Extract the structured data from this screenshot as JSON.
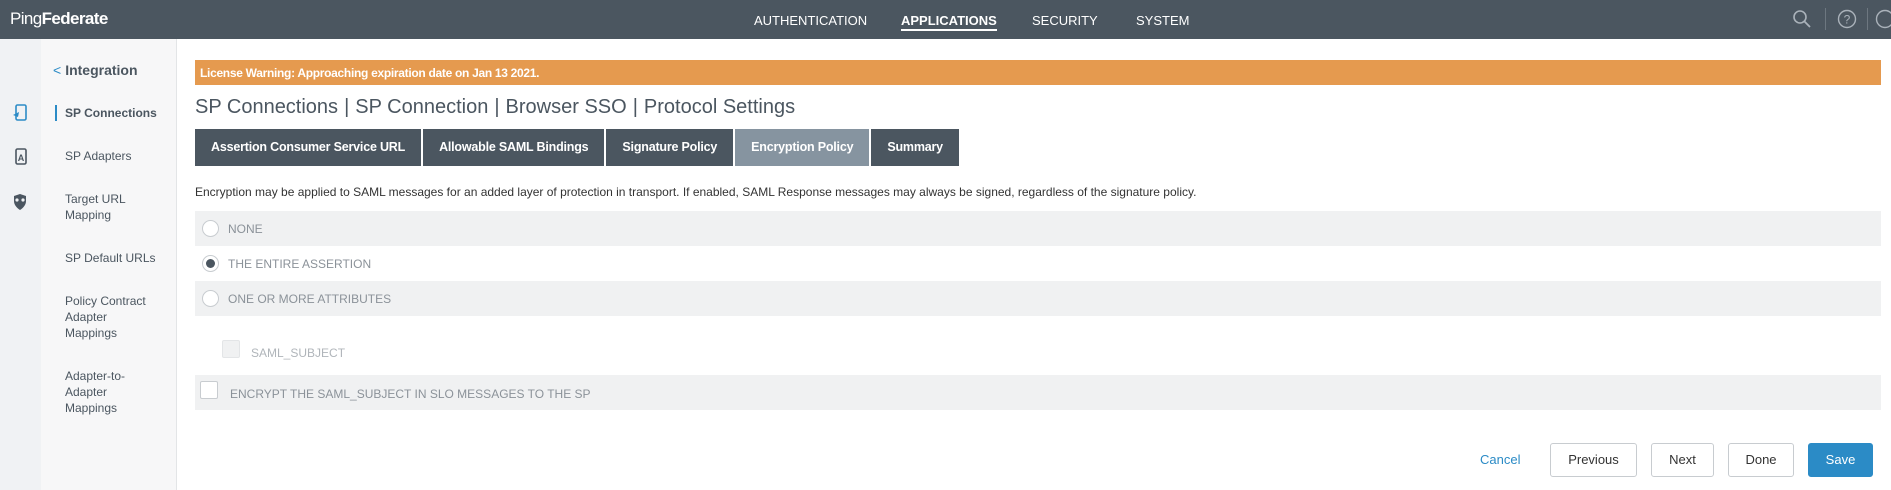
{
  "app": {
    "logo_regular": "Ping",
    "logo_bold": "Federate"
  },
  "nav": {
    "items": [
      "AUTHENTICATION",
      "APPLICATIONS",
      "SECURITY",
      "SYSTEM"
    ],
    "active": "APPLICATIONS"
  },
  "subnav": {
    "back_label": "Integration",
    "items": [
      {
        "label": "SP Connections",
        "active": true
      },
      {
        "label": "SP Adapters"
      },
      {
        "label": "Target URL Mapping"
      },
      {
        "label": "SP Default URLs"
      },
      {
        "label": "Policy Contract Adapter Mappings"
      },
      {
        "label": "Adapter-to-Adapter Mappings"
      }
    ]
  },
  "warning": "License Warning: Approaching expiration date on Jan 13 2021.",
  "breadcrumb": [
    "SP Connections",
    "SP Connection",
    "Browser SSO",
    "Protocol Settings"
  ],
  "tabs": [
    "Assertion Consumer Service URL",
    "Allowable SAML Bindings",
    "Signature Policy",
    "Encryption Policy",
    "Summary"
  ],
  "active_tab": "Encryption Policy",
  "description": "Encryption may be applied to SAML messages for an added layer of protection in transport. If enabled, SAML Response messages may always be signed, regardless of the signature policy.",
  "options": {
    "none": "NONE",
    "entire": "THE ENTIRE ASSERTION",
    "attributes": "ONE OR MORE ATTRIBUTES",
    "selected": "THE ENTIRE ASSERTION"
  },
  "attribute_checkbox": "SAML_SUBJECT",
  "slo_checkbox": "ENCRYPT THE SAML_SUBJECT IN SLO MESSAGES TO THE SP",
  "buttons": {
    "cancel": "Cancel",
    "previous": "Previous",
    "next": "Next",
    "done": "Done",
    "save": "Save"
  },
  "colors": {
    "header": "#4b5660",
    "warning": "#e59a4f",
    "accent": "#2b8bc6",
    "active_tab": "#8694a0"
  }
}
